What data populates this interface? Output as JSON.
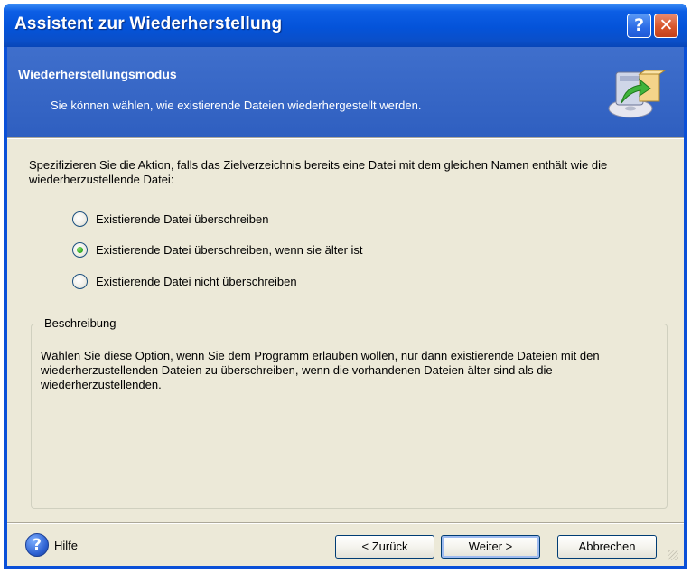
{
  "window": {
    "title": "Assistent zur Wiederherstellung",
    "help_glyph": "?",
    "close_glyph": "✕"
  },
  "header": {
    "title": "Wiederherstellungsmodus",
    "subtitle": "Sie können wählen, wie existierende Dateien wiederhergestellt werden."
  },
  "main": {
    "instruction": "Spezifizieren Sie die Aktion, falls das Zielverzeichnis bereits eine Datei mit dem gleichen Namen enthält wie die wiederherzustellende Datei:",
    "options": [
      {
        "label": "Existierende Datei überschreiben",
        "checked": false
      },
      {
        "label": "Existierende Datei überschreiben, wenn sie älter ist",
        "checked": true
      },
      {
        "label": "Existierende Datei nicht überschreiben",
        "checked": false
      }
    ],
    "description_title": "Beschreibung",
    "description_text": "Wählen Sie diese Option, wenn Sie dem Programm erlauben wollen, nur dann existierende Dateien mit den wiederherzustellenden Dateien zu überschreiben, wenn die vorhandenen Dateien älter sind als die wiederherzustellenden."
  },
  "footer": {
    "help_label": "Hilfe",
    "back_label": "< Zurück",
    "next_label": "Weiter >",
    "cancel_label": "Abbrechen"
  },
  "icons": {
    "header_icon": "restore-disk-icon",
    "help_icon": "help-question-icon"
  },
  "colors": {
    "titlebar": "#0453d9",
    "header_band": "#3f6fcc",
    "dialog_bg": "#ece9d8",
    "close_button": "#d7552b",
    "radio_checked": "#2aa81c"
  }
}
